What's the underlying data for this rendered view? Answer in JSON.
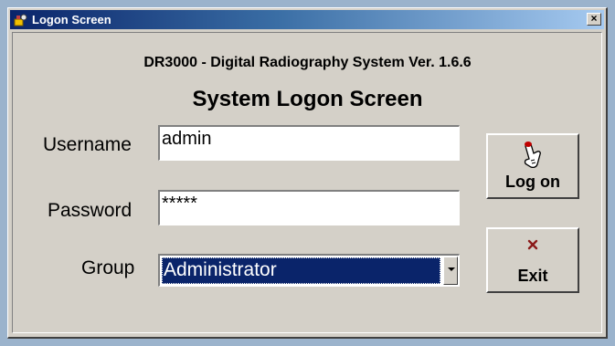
{
  "window": {
    "title": "Logon Screen",
    "close_label": "×"
  },
  "form": {
    "subtitle": "DR3000 - Digital Radiography System  Ver.  1.6.6",
    "heading": "System Logon Screen",
    "username_label": "Username",
    "username_value": "admin",
    "password_label": "Password",
    "password_value": "*****",
    "group_label": "Group",
    "group_value": "Administrator"
  },
  "buttons": {
    "logon_label": "Log on",
    "logon_icon": "hand-pointer-icon",
    "exit_label": "Exit",
    "exit_icon": "x-mark-icon"
  },
  "colors": {
    "titlebar_start": "#0a246a",
    "titlebar_end": "#a6caf0",
    "window_face": "#d4d0c8",
    "selection": "#0a246a"
  }
}
